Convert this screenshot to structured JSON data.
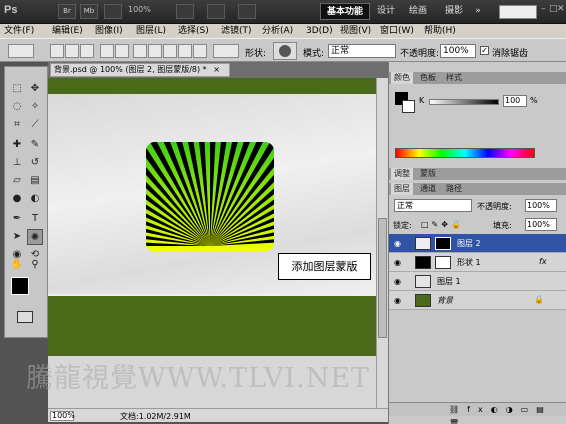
{
  "titlebar": {
    "logo": "Ps",
    "btn_br": "Br",
    "btn_mb": "Mb",
    "zoom": "100%",
    "workspaces": [
      "基本功能",
      "设计",
      "绘画",
      "摄影"
    ],
    "more": "»",
    "wctl_min": "–",
    "wctl_max": "□",
    "wctl_close": "✕"
  },
  "menu": [
    "文件(F)",
    "编辑(E)",
    "图像(I)",
    "图层(L)",
    "选择(S)",
    "滤镜(T)",
    "分析(A)",
    "3D(D)",
    "视图(V)",
    "窗口(W)",
    "帮助(H)"
  ],
  "options": {
    "shape_label": "形状:",
    "mode_label": "模式:",
    "mode_value": "正常",
    "opacity_label": "不透明度:",
    "opacity_value": "100%",
    "antialias_label": "消除锯齿"
  },
  "document": {
    "tab_title": "背景.psd @ 100% (图层 2, 图层蒙版/8) *",
    "tab_close": "×",
    "callout": "添加图层蒙版",
    "zoom": "100%",
    "doc_info": "文档:1.02M/2.91M"
  },
  "colors": {
    "canvas_band": "#4a6a1a",
    "burst_green": "#3ccf17",
    "burst_yellow": "#f2ff00"
  },
  "panel_color": {
    "tabs": [
      "颜色",
      "色板",
      "样式"
    ],
    "channel": "K",
    "value": "100",
    "unit": "%"
  },
  "panel_adjust": {
    "tabs": [
      "调整",
      "蒙版"
    ]
  },
  "panel_layers": {
    "tabs": [
      "图层",
      "通道",
      "路径"
    ],
    "blend": "正常",
    "opacity_label": "不透明度:",
    "opacity_value": "100%",
    "lock_label": "锁定:",
    "fill_label": "填充:",
    "fill_value": "100%",
    "layers": [
      {
        "name": "图层 2",
        "selected": true
      },
      {
        "name": "形状 1",
        "fx": "fx"
      },
      {
        "name": "图层 1"
      },
      {
        "name": "背景"
      }
    ]
  },
  "watermark": "騰龍視覺WWW.TLVI.NET"
}
